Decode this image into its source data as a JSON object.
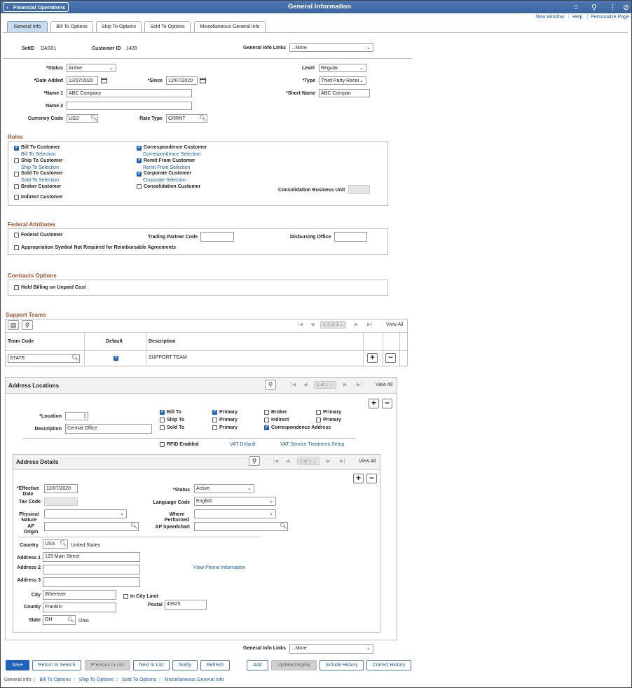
{
  "header": {
    "back_label": "Financial Operations",
    "title": "General Information"
  },
  "top_links": [
    "New Window",
    "Help",
    "Personalize Page"
  ],
  "tabs": [
    "General Info",
    "Bill To Options",
    "Ship To Options",
    "Sold To Options",
    "Miscellaneous General Info"
  ],
  "keys": {
    "setid_label": "SetID",
    "setid": "DAS01",
    "custid_label": "Customer ID",
    "custid": "1428",
    "links_label": "General Info Links",
    "links_value": "...More"
  },
  "fields": {
    "status_label": "*Status",
    "status": "Active",
    "level_label": "Level",
    "level": "Regular",
    "date_added_label": "*Date Added",
    "date_added": "12/07/2020",
    "since_label": "*Since",
    "since": "12/07/2020",
    "type_label": "*Type",
    "type": "Third Party Recei",
    "name1_label": "*Name 1",
    "name1": "ABC Company",
    "short_label": "*Short Name",
    "short": "ABC Compan",
    "name2_label": "Name 2",
    "name2": "",
    "currency_label": "Currency Code",
    "currency": "USD",
    "rate_label": "Rate Type",
    "rate": "CRRNT"
  },
  "roles": {
    "title": "Roles",
    "bill_to": "Bill To Customer",
    "bill_to_link": "Bill To Selection",
    "ship_to": "Ship To Customer",
    "ship_to_link": "Ship To Selection",
    "sold_to": "Sold To Customer",
    "sold_to_link": "Sold To Selection",
    "broker": "Broker Customer",
    "indirect": "Indirect Customer",
    "corr": "Correspondence Customer",
    "corr_link": "Correspondence Selection",
    "remit": "Remit From Customer",
    "remit_link": "Remit From Selection",
    "corporate": "Corporate Customer",
    "corporate_link": "Corporate Selection",
    "consol": "Consolidation Customer",
    "consol_bu": "Consolidation Business Unit"
  },
  "federal": {
    "title": "Federal Attributes",
    "fed_customer": "Federal Customer",
    "trading": "Trading Partner Code",
    "disbursing": "Disbursing Office",
    "approp": "Appropriation Symbol Not Required for Reimbursable Agreements"
  },
  "contracts": {
    "title": "Contracts Options",
    "hold": "Hold Billing on Unpaid Cost"
  },
  "support": {
    "title": "Support Teams",
    "pager": "1-1 of 1",
    "view_all": "View All",
    "col_team": "Team Code",
    "col_default": "Default",
    "col_desc": "Description",
    "team": "STATE",
    "desc": "SUPPORT TEAM"
  },
  "address": {
    "title": "Address Locations",
    "pager": "1 of 1",
    "view_all": "View All",
    "location_label": "*Location",
    "location": "1",
    "desc_label": "Description",
    "desc": "Central Office",
    "bill_to": "Bill To",
    "ship_to": "Ship To",
    "sold_to": "Sold To",
    "primary": "Primary",
    "broker": "Broker",
    "indirect": "Indirect",
    "corr": "Correspondence Address",
    "rfid": "RFID Enabled",
    "vat_default": "VAT Default",
    "vat_service": "VAT Service Treatment Setup"
  },
  "details": {
    "title": "Address Details",
    "pager": "1 of 1",
    "view_all": "View All",
    "eff_label": "*Effective Date",
    "eff": "12/07/2020",
    "status_label": "*Status",
    "status": "Active",
    "tax_label": "Tax Code",
    "lang_label": "Language Code",
    "lang": "English",
    "phys_label": "Physical Nature",
    "where_label": "Where Performed",
    "ap_origin_label": "AP Origin",
    "ap_speed_label": "AP Speedchart",
    "country_label": "Country",
    "country": "USA",
    "country_name": "United States",
    "addr1_label": "Address 1",
    "addr1": "123 Main Street",
    "addr2_label": "Address 2",
    "addr3_label": "Address 3",
    "phone_link": "View Phone Information",
    "city_label": "City",
    "city": "Wherever",
    "in_city": "In City Limit",
    "county_label": "County",
    "county": "Franklin",
    "postal_label": "Postal",
    "postal": "43925",
    "state_label": "State",
    "state": "OH",
    "state_name": "Ohio"
  },
  "bottom": {
    "links_label": "General Info Links",
    "links_value": "...More"
  },
  "buttons": [
    "Save",
    "Return to Search",
    "Previous in List",
    "Next in List",
    "Notify",
    "Refresh",
    "Add",
    "Update/Display",
    "Include History",
    "Correct History"
  ],
  "footer": [
    "General Info",
    "Bill To Options",
    "Ship To Options",
    "Sold To Options",
    "Miscellaneous General Info"
  ]
}
